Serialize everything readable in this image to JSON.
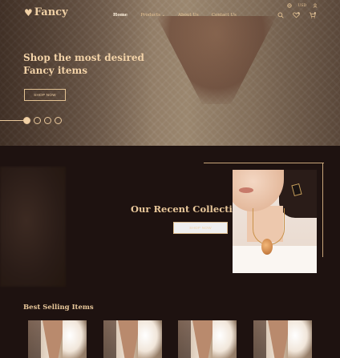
{
  "brand": {
    "name": "Fancy",
    "logo_icon": "heart-icon"
  },
  "nav": {
    "links": [
      {
        "label": "Home",
        "active": true
      },
      {
        "label": "Products",
        "has_dropdown": true
      },
      {
        "label": "About Us"
      },
      {
        "label": "Contact Us"
      }
    ],
    "utility": {
      "currency": "USD",
      "icons": [
        "globe-icon",
        "user-icon"
      ]
    },
    "icons": [
      "search-icon",
      "wishlist-icon",
      "cart-icon"
    ]
  },
  "hero": {
    "title_line1": "Shop the most desired",
    "title_line2": "Fancy items",
    "button_label": "SHOP NOW",
    "slider": {
      "count": 4,
      "active_index": 0
    }
  },
  "collection": {
    "title": "Our Recent Collection",
    "button_label": "SHOP NOW"
  },
  "best_selling": {
    "title": "Best Selling Items",
    "items": [
      {
        "image": "necklace-product-1"
      },
      {
        "image": "necklace-product-2"
      },
      {
        "image": "necklace-product-3"
      },
      {
        "image": "necklace-product-4"
      }
    ]
  },
  "colors": {
    "background": "#1e1210",
    "accent": "#e9c89b",
    "accent_light": "#f3d3a8"
  }
}
